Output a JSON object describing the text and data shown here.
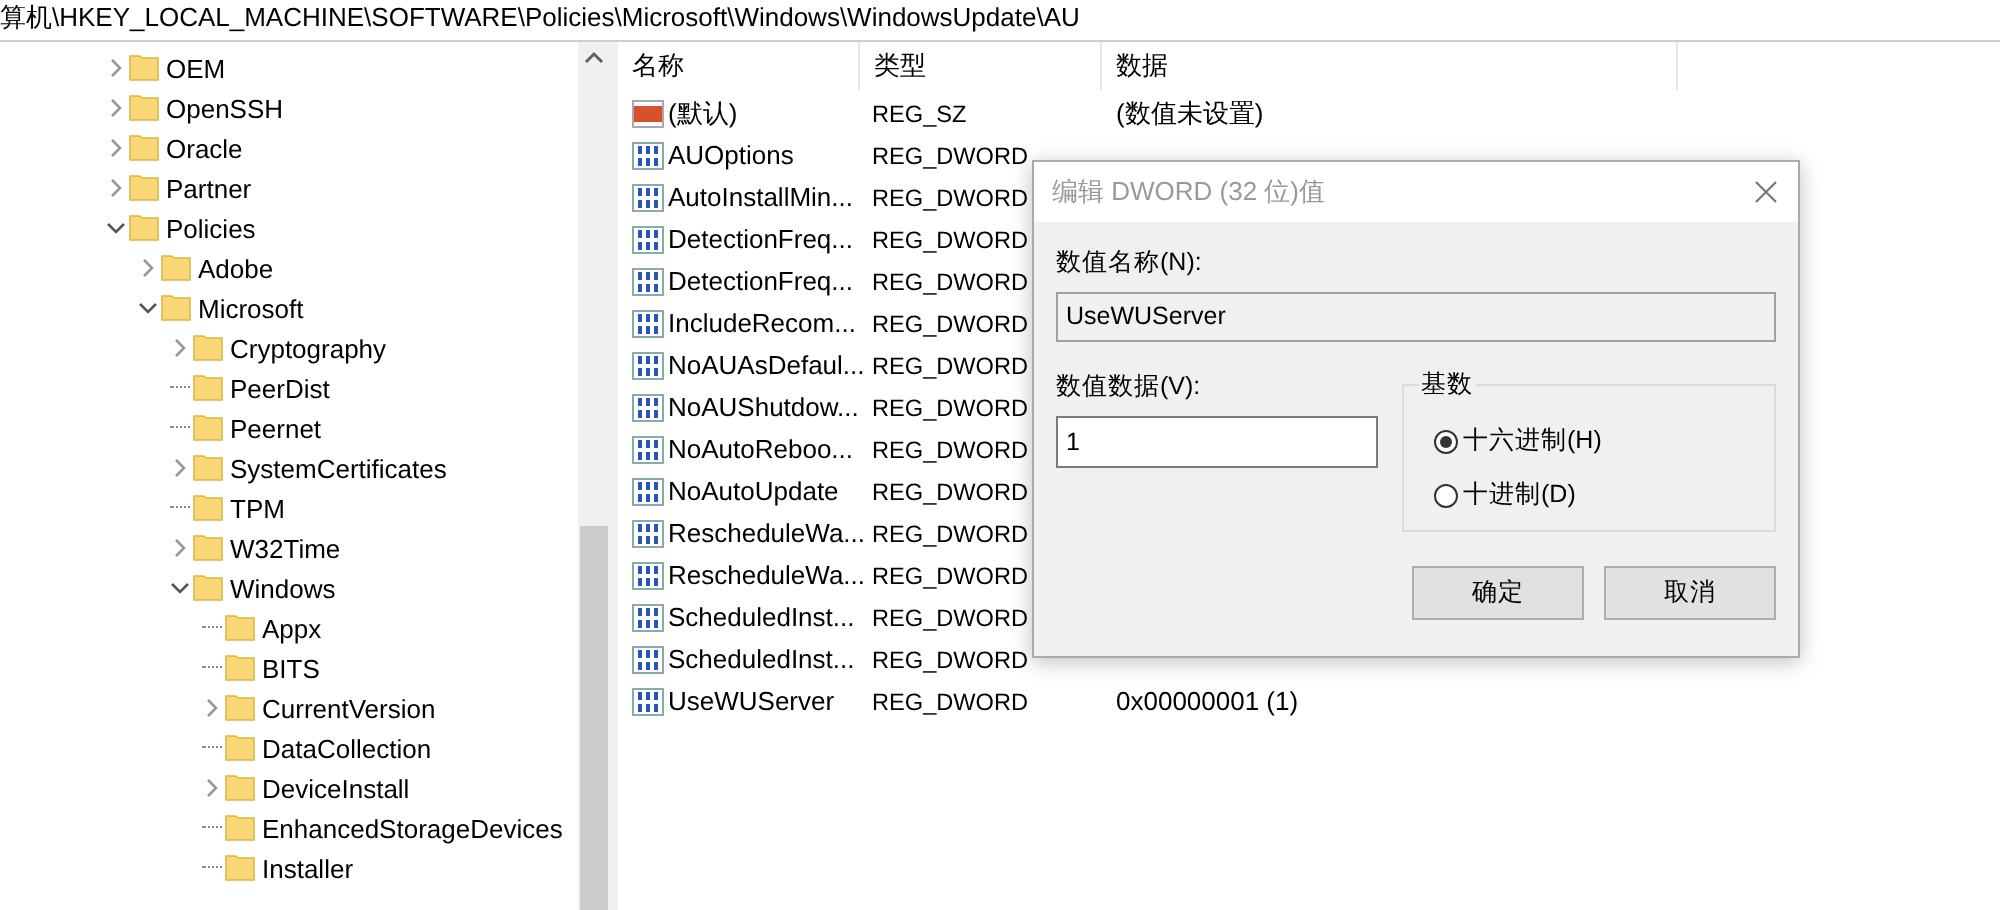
{
  "address_bar": {
    "path": "算机\\HKEY_LOCAL_MACHINE\\SOFTWARE\\Policies\\Microsoft\\Windows\\WindowsUpdate\\AU"
  },
  "tree": [
    {
      "label": "OEM",
      "kind": "branch",
      "expanded": false
    },
    {
      "label": "OpenSSH",
      "kind": "branch",
      "expanded": false
    },
    {
      "label": "Oracle",
      "kind": "branch",
      "expanded": false
    },
    {
      "label": "Partner",
      "kind": "branch",
      "expanded": false
    },
    {
      "label": "Policies",
      "kind": "branch",
      "expanded": true,
      "children": [
        {
          "label": "Adobe",
          "kind": "branch",
          "expanded": false
        },
        {
          "label": "Microsoft",
          "kind": "branch",
          "expanded": true,
          "children": [
            {
              "label": "Cryptography",
              "kind": "branch",
              "expanded": false
            },
            {
              "label": "PeerDist",
              "kind": "leaf"
            },
            {
              "label": "Peernet",
              "kind": "leaf"
            },
            {
              "label": "SystemCertificates",
              "kind": "branch",
              "expanded": false
            },
            {
              "label": "TPM",
              "kind": "leaf"
            },
            {
              "label": "W32Time",
              "kind": "branch",
              "expanded": false
            },
            {
              "label": "Windows",
              "kind": "branch",
              "expanded": true,
              "children": [
                {
                  "label": "Appx",
                  "kind": "leaf"
                },
                {
                  "label": "BITS",
                  "kind": "leaf"
                },
                {
                  "label": "CurrentVersion",
                  "kind": "branch",
                  "expanded": false
                },
                {
                  "label": "DataCollection",
                  "kind": "leaf"
                },
                {
                  "label": "DeviceInstall",
                  "kind": "branch",
                  "expanded": false
                },
                {
                  "label": "EnhancedStorageDevices",
                  "kind": "leaf"
                },
                {
                  "label": "Installer",
                  "kind": "leaf"
                }
              ]
            }
          ]
        }
      ]
    }
  ],
  "values_table": {
    "columns": [
      "名称",
      "类型",
      "数据"
    ],
    "rows": [
      {
        "name": "(默认)",
        "kind": "string",
        "type": "REG_SZ",
        "data": "(数值未设置)"
      },
      {
        "name": "AUOptions",
        "kind": "dword",
        "type": "REG_DWORD"
      },
      {
        "name": "AutoInstallMin...",
        "kind": "dword",
        "type": "REG_DWORD"
      },
      {
        "name": "DetectionFreq...",
        "kind": "dword",
        "type": "REG_DWORD"
      },
      {
        "name": "DetectionFreq...",
        "kind": "dword",
        "type": "REG_DWORD"
      },
      {
        "name": "IncludeRecom...",
        "kind": "dword",
        "type": "REG_DWORD"
      },
      {
        "name": "NoAUAsDefaul...",
        "kind": "dword",
        "type": "REG_DWORD"
      },
      {
        "name": "NoAUShutdow...",
        "kind": "dword",
        "type": "REG_DWORD"
      },
      {
        "name": "NoAutoReboo...",
        "kind": "dword",
        "type": "REG_DWORD"
      },
      {
        "name": "NoAutoUpdate",
        "kind": "dword",
        "type": "REG_DWORD"
      },
      {
        "name": "RescheduleWa...",
        "kind": "dword",
        "type": "REG_DWORD"
      },
      {
        "name": "RescheduleWa...",
        "kind": "dword",
        "type": "REG_DWORD"
      },
      {
        "name": "ScheduledInst...",
        "kind": "dword",
        "type": "REG_DWORD"
      },
      {
        "name": "ScheduledInst...",
        "kind": "dword",
        "type": "REG_DWORD"
      },
      {
        "name": "UseWUServer",
        "kind": "dword",
        "type": "REG_DWORD",
        "data": "0x00000001 (1)"
      }
    ]
  },
  "dialog": {
    "title": "编辑 DWORD (32 位)值",
    "name_label": "数值名称(N):",
    "name_value": "UseWUServer",
    "data_label": "数值数据(V):",
    "data_value": "1",
    "base_group": {
      "title": "基数",
      "options": [
        {
          "label": "十六进制(H)",
          "selected": true
        },
        {
          "label": "十进制(D)",
          "selected": false
        }
      ]
    },
    "buttons": [
      "确定",
      "取消"
    ]
  }
}
